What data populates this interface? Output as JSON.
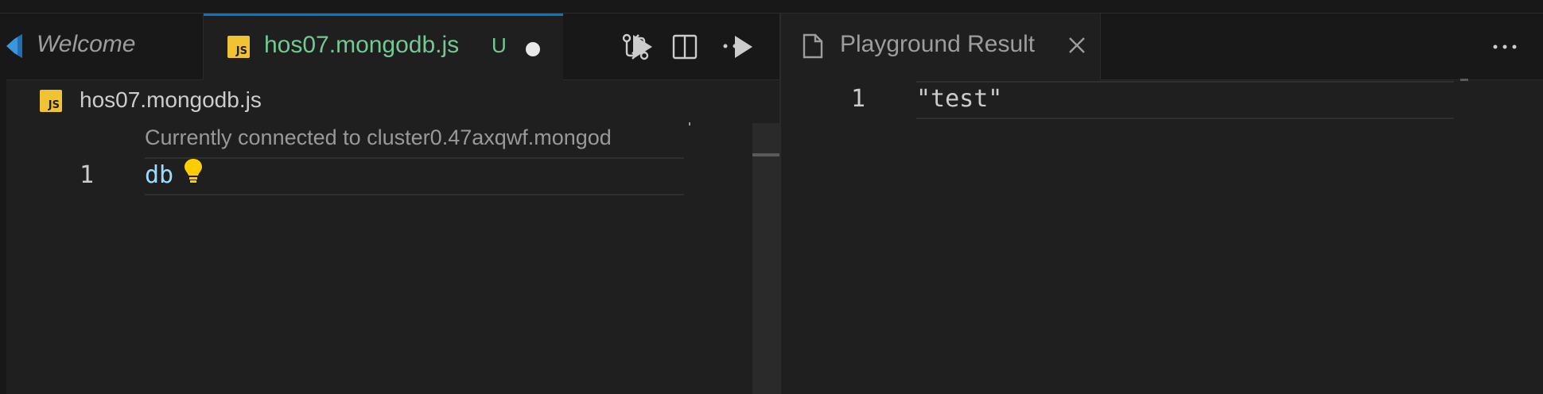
{
  "left_group": {
    "tabs": [
      {
        "label": "Welcome",
        "state": "inactive"
      },
      {
        "label": "hos07.mongodb.js",
        "git_status": "U",
        "state": "active",
        "dirty": true,
        "icon_text": "JS"
      }
    ],
    "actions": [
      "run-icon",
      "compare-changes-icon",
      "split-editor-icon",
      "more-actions-icon"
    ],
    "breadcrumb": {
      "file": "hos07.mongodb.js",
      "icon_text": "JS"
    },
    "codelens": "Currently connected to cluster0.47axqwf.mongod",
    "lines": [
      {
        "number": "1",
        "code": "db"
      }
    ]
  },
  "right_group": {
    "tabs": [
      {
        "label": "Playground Result",
        "state": "active"
      }
    ],
    "actions": [
      "more-actions-icon"
    ],
    "lines": [
      {
        "number": "1",
        "code": "\"test\""
      }
    ]
  },
  "colors": {
    "accent": "#0078d4",
    "git_untracked": "#73c991",
    "variable": "#9cdcfe",
    "js_badge": "#f1c232",
    "lightbulb": "#ffcc00"
  }
}
